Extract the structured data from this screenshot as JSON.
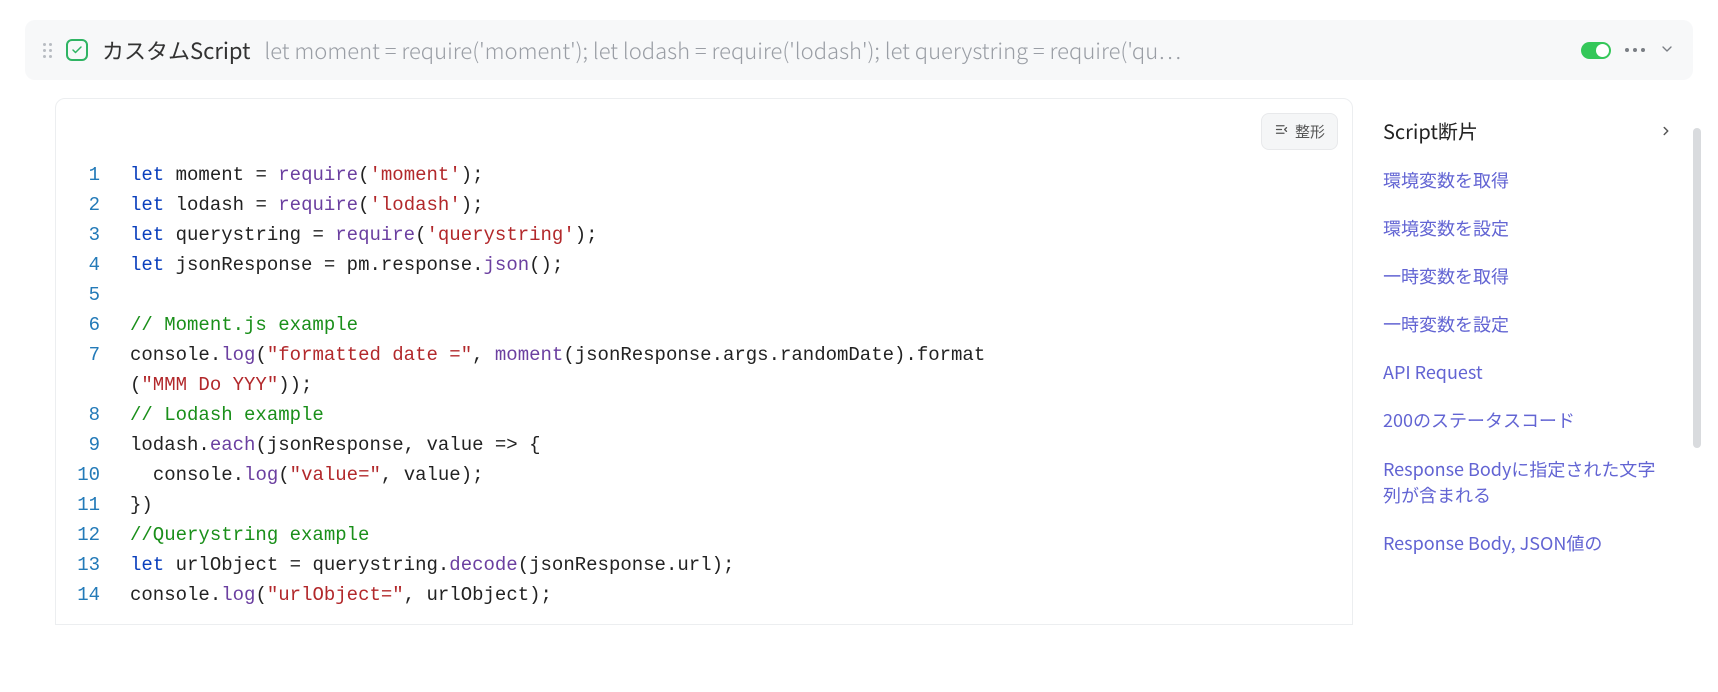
{
  "header": {
    "title": "カスタムScript",
    "preview": "let moment = require('moment'); let lodash = require('lodash'); let querystring = require('qu…",
    "format_button": "整形"
  },
  "code": {
    "lines": [
      {
        "n": "1",
        "tokens": [
          [
            "kw",
            "let"
          ],
          [
            "pn",
            " "
          ],
          [
            "id",
            "moment"
          ],
          [
            "pn",
            " "
          ],
          [
            "pn",
            "="
          ],
          [
            "pn",
            " "
          ],
          [
            "fn",
            "require"
          ],
          [
            "pn",
            "("
          ],
          [
            "sq",
            "'moment'"
          ],
          [
            "pn",
            ")"
          ],
          [
            "pn",
            ";"
          ]
        ]
      },
      {
        "n": "2",
        "tokens": [
          [
            "kw",
            "let"
          ],
          [
            "pn",
            " "
          ],
          [
            "id",
            "lodash"
          ],
          [
            "pn",
            " "
          ],
          [
            "pn",
            "="
          ],
          [
            "pn",
            " "
          ],
          [
            "fn",
            "require"
          ],
          [
            "pn",
            "("
          ],
          [
            "sq",
            "'lodash'"
          ],
          [
            "pn",
            ")"
          ],
          [
            "pn",
            ";"
          ]
        ]
      },
      {
        "n": "3",
        "tokens": [
          [
            "kw",
            "let"
          ],
          [
            "pn",
            " "
          ],
          [
            "id",
            "querystring"
          ],
          [
            "pn",
            " "
          ],
          [
            "pn",
            "="
          ],
          [
            "pn",
            " "
          ],
          [
            "fn",
            "require"
          ],
          [
            "pn",
            "("
          ],
          [
            "sq",
            "'querystring'"
          ],
          [
            "pn",
            ")"
          ],
          [
            "pn",
            ";"
          ]
        ]
      },
      {
        "n": "4",
        "tokens": [
          [
            "kw",
            "let"
          ],
          [
            "pn",
            " "
          ],
          [
            "id",
            "jsonResponse"
          ],
          [
            "pn",
            " "
          ],
          [
            "pn",
            "="
          ],
          [
            "pn",
            " "
          ],
          [
            "id",
            "pm"
          ],
          [
            "pn",
            "."
          ],
          [
            "id",
            "response"
          ],
          [
            "pn",
            "."
          ],
          [
            "fn",
            "json"
          ],
          [
            "pn",
            "("
          ],
          [
            "pn",
            ")"
          ],
          [
            "pn",
            ";"
          ]
        ]
      },
      {
        "n": "5",
        "tokens": []
      },
      {
        "n": "6",
        "tokens": [
          [
            "cm",
            "// Moment.js example"
          ]
        ]
      },
      {
        "n": "7",
        "tokens": [
          [
            "id",
            "console"
          ],
          [
            "pn",
            "."
          ],
          [
            "fn",
            "log"
          ],
          [
            "pn",
            "("
          ],
          [
            "str",
            "\"formatted date =\""
          ],
          [
            "pn",
            ","
          ],
          [
            "pn",
            " "
          ],
          [
            "fn",
            "moment"
          ],
          [
            "pn",
            "("
          ],
          [
            "id",
            "jsonResponse"
          ],
          [
            "pn",
            "."
          ],
          [
            "id",
            "args"
          ],
          [
            "pn",
            "."
          ],
          [
            "id",
            "randomDate"
          ],
          [
            "pn",
            ")"
          ],
          [
            "pn",
            "."
          ],
          [
            "id",
            "format"
          ]
        ]
      },
      {
        "n": "",
        "tokens": [
          [
            "pn",
            "("
          ],
          [
            "str",
            "\"MMM Do YYY\""
          ],
          [
            "pn",
            ")"
          ],
          [
            "pn",
            ")"
          ],
          [
            "pn",
            ";"
          ]
        ]
      },
      {
        "n": "8",
        "tokens": [
          [
            "cm",
            "// Lodash example"
          ]
        ]
      },
      {
        "n": "9",
        "tokens": [
          [
            "id",
            "lodash"
          ],
          [
            "pn",
            "."
          ],
          [
            "fn",
            "each"
          ],
          [
            "pn",
            "("
          ],
          [
            "id",
            "jsonResponse"
          ],
          [
            "pn",
            ","
          ],
          [
            "pn",
            " "
          ],
          [
            "id",
            "value"
          ],
          [
            "pn",
            " "
          ],
          [
            "pn",
            "=>"
          ],
          [
            "pn",
            " "
          ],
          [
            "pn",
            "{"
          ]
        ]
      },
      {
        "n": "10",
        "tokens": [
          [
            "pn",
            "  "
          ],
          [
            "id",
            "console"
          ],
          [
            "pn",
            "."
          ],
          [
            "fn",
            "log"
          ],
          [
            "pn",
            "("
          ],
          [
            "str",
            "\"value=\""
          ],
          [
            "pn",
            ","
          ],
          [
            "pn",
            " "
          ],
          [
            "id",
            "value"
          ],
          [
            "pn",
            ")"
          ],
          [
            "pn",
            ";"
          ]
        ]
      },
      {
        "n": "11",
        "tokens": [
          [
            "pn",
            "}"
          ],
          [
            "pn",
            ")"
          ]
        ]
      },
      {
        "n": "12",
        "tokens": [
          [
            "cm",
            "//Querystring example"
          ]
        ]
      },
      {
        "n": "13",
        "tokens": [
          [
            "kw",
            "let"
          ],
          [
            "pn",
            " "
          ],
          [
            "id",
            "urlObject"
          ],
          [
            "pn",
            " "
          ],
          [
            "pn",
            "="
          ],
          [
            "pn",
            " "
          ],
          [
            "id",
            "querystring"
          ],
          [
            "pn",
            "."
          ],
          [
            "fn",
            "decode"
          ],
          [
            "pn",
            "("
          ],
          [
            "id",
            "jsonResponse"
          ],
          [
            "pn",
            "."
          ],
          [
            "id",
            "url"
          ],
          [
            "pn",
            ")"
          ],
          [
            "pn",
            ";"
          ]
        ]
      },
      {
        "n": "14",
        "tokens": [
          [
            "id",
            "console"
          ],
          [
            "pn",
            "."
          ],
          [
            "fn",
            "log"
          ],
          [
            "pn",
            "("
          ],
          [
            "str",
            "\"urlObject=\""
          ],
          [
            "pn",
            ","
          ],
          [
            "pn",
            " "
          ],
          [
            "id",
            "urlObject"
          ],
          [
            "pn",
            ")"
          ],
          [
            "pn",
            ";"
          ]
        ]
      }
    ]
  },
  "side": {
    "title": "Script断片",
    "snippets": [
      "環境変数を取得",
      "環境変数を設定",
      "一時変数を取得",
      "一時変数を設定",
      "API Request",
      "200のステータスコード",
      "Response Bodyに指定された文字列が含まれる",
      "Response Body, JSON値の"
    ]
  }
}
